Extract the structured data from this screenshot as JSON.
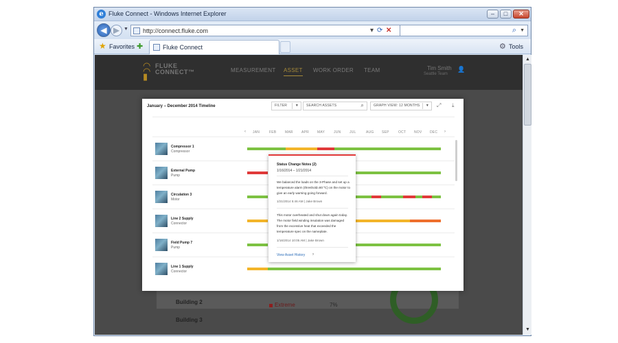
{
  "window": {
    "title": "Fluke Connect - Windows Internet Explorer",
    "controls": {
      "minimize": "–",
      "maximize": "□",
      "close": "✕"
    }
  },
  "navbar": {
    "url": "http://connect.fluke.com",
    "search_placeholder": ""
  },
  "favorites_bar": {
    "favorites_label": "Favorites",
    "tab_label": "Fluke Connect",
    "tools_label": "Tools"
  },
  "app": {
    "logo_line1": "FLUKE",
    "logo_line2": "CONNECT™",
    "menu": [
      {
        "label": "MEASUREMENT",
        "active": false
      },
      {
        "label": "ASSET",
        "active": true
      },
      {
        "label": "WORK ORDER",
        "active": false
      },
      {
        "label": "TEAM",
        "active": false
      }
    ],
    "user_name": "Tim Smith",
    "user_team": "Seattle Team"
  },
  "background": {
    "buildings": [
      "Building 2",
      "Building 3"
    ],
    "extreme_label": "Extreme",
    "extreme_pct": "7%"
  },
  "modal": {
    "title": "January – December 2014 Timeline",
    "filter_label": "FILTER",
    "search_label": "SEARCH ASSETS",
    "graph_view_label": "GRAPH VIEW: 12 MONTHS",
    "months": [
      "JAN",
      "FEB",
      "MAR",
      "APR",
      "MAY",
      "JUN",
      "JUL",
      "AUG",
      "SEP",
      "OCT",
      "NOV",
      "DEC"
    ],
    "assets": [
      {
        "name": "Compressor 1",
        "type": "Compressor"
      },
      {
        "name": "External Pump",
        "type": "Pump"
      },
      {
        "name": "Circulation 3",
        "type": "Motor"
      },
      {
        "name": "Line 2 Supply",
        "type": "Connector"
      },
      {
        "name": "Field Pump 7",
        "type": "Pump"
      },
      {
        "name": "Line 1 Supply",
        "type": "Connector"
      }
    ],
    "status_colors": {
      "normal": "#7dc242",
      "alert": "#f3b52a",
      "critical": "#e03a3a",
      "warning": "#ee6f2d"
    }
  },
  "popover": {
    "title": "Status Change Notes (2)",
    "date_range": "1/16/2014 – 1/21/2014",
    "note1": "We balanced the loads on the 3-Phase and set up a temperature alarm (threshold=80 ºC) on the motor to give an early warning going forward.",
    "note1_meta": "1/21/2014   5:46 AM   |   Jake Brown",
    "note2": "This motor overheated and shut down again today. The motor field winding insulation was damaged from the excessive heat that exceeded the temperature spec on the nameplate.",
    "note2_meta": "1/16/2014   10:05 AM   |   Jake Brown",
    "history_link": "View Asset History"
  }
}
